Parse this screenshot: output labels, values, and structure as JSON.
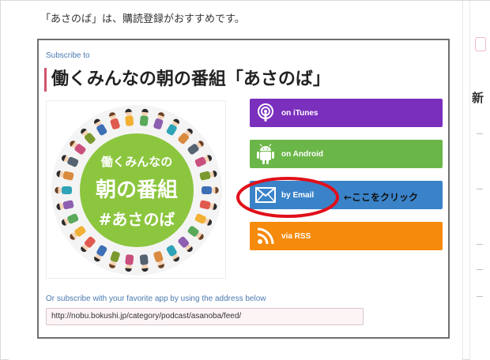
{
  "intro": {
    "text": "「あさのば」は、購読登録がおすすめです。"
  },
  "subscribe": {
    "heading": "Subscribe to",
    "title": "働くみんなの朝の番組「あさのば」",
    "artwork": {
      "line1": "働くみんなの",
      "line2": "朝の番組",
      "line3": "#あさのば"
    },
    "buttons": [
      {
        "label": "on iTunes",
        "icon": "podcast-icon",
        "color": "#7b2fbd"
      },
      {
        "label": "on Android",
        "icon": "android-icon",
        "color": "#6bb649"
      },
      {
        "label": "by Email",
        "icon": "email-icon",
        "color": "#3a83c9"
      },
      {
        "label": "via RSS",
        "icon": "rss-icon",
        "color": "#f58a0c"
      }
    ],
    "annotation": "←ここをクリック",
    "alt_text": "Or subscribe with your favorite app by using the address below",
    "feed_url": "http://nobu.bokushi.jp/category/podcast/asanoba/feed/"
  },
  "sidebar": {
    "char": "新"
  },
  "colors": {
    "highlight": "#e0101a",
    "title_accent": "#d2546b",
    "link": "#4a7ab0"
  }
}
